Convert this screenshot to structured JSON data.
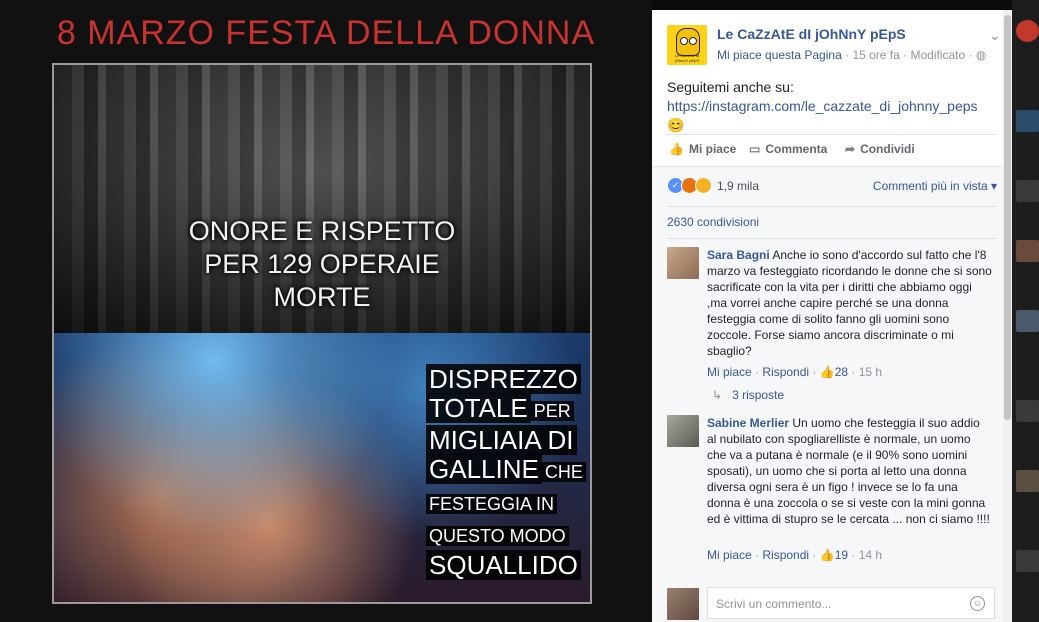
{
  "poster": {
    "title": "8 MARZO FESTA DELLA DONNA",
    "top_caption": [
      "ONORE E RISPETTO",
      "PER 129 OPERAIE",
      "MORTE"
    ],
    "bottom_caption": {
      "l1": "DISPREZZO",
      "l2a": "TOTALE",
      "l2b": "PER",
      "l3": "MIGLIAIA DI",
      "l4a": "GALLINE",
      "l4b": "CHE",
      "l5": "FESTEGGIA IN",
      "l6": "QUESTO MODO",
      "l7": "SQUALLIDO"
    }
  },
  "post": {
    "page_name": "Le CaZzAtE dI jOhNnY pEpS",
    "logo_tag": "Le Cazzate di jOhnnY pEpS",
    "like_page": "Mi piace questa Pagina",
    "time": "15 ore fa",
    "modified": "Modificato",
    "text_prefix": "Seguitemi anche su:",
    "link": "https://instagram.com/le_cazzate_di_johnny_peps",
    "emoji": "😊"
  },
  "actions": {
    "like": "Mi piace",
    "comment": "Commenta",
    "share": "Condividi"
  },
  "reactions": {
    "count": "1,9 mila",
    "sort": "Commenti più in vista",
    "shares": "2630 condivisioni"
  },
  "comments": [
    {
      "name": "Sara Bagni",
      "text": "Anche io sono d'accordo sul fatto che l'8 marzo va festeggiato ricordando le donne che si sono sacrificate con la vita per i diritti che abbiamo oggi ,ma vorrei anche capire perché se una donna festeggia come di solito fanno gli uomini sono zoccole. Forse siamo ancora discriminate o mi sbaglio?",
      "like": "Mi piace",
      "reply": "Rispondi",
      "likes": "28",
      "time": "15 h",
      "replies": "3 risposte"
    },
    {
      "name": "Sabine Merlier",
      "text": "Un uomo che festeggia il suo addio al nubilato con spogliarelliste è normale, un uomo che va a putana è normale (e il 90% sono uomini sposati), un uomo che si porta al letto una donna diversa ogni sera è un figo ! invece se lo fa una donna è una zoccola o se si veste con la mini gonna ed è vittima di stupro se le cercata ... non ci siamo !!!!",
      "like": "Mi piace",
      "reply": "Rispondi",
      "likes": "19",
      "time": "14 h"
    }
  ],
  "composer": {
    "placeholder": "Scrivi un commento..."
  },
  "colors": {
    "link": "#365899",
    "title_red": "#c8332e",
    "muted": "#90949c"
  }
}
